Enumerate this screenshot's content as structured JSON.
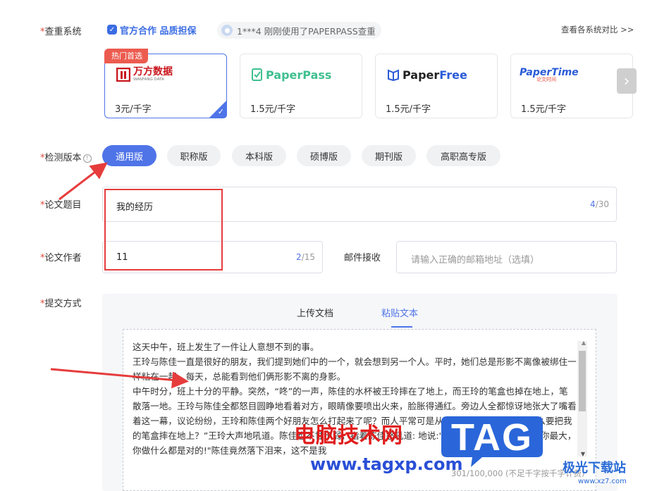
{
  "check_system": {
    "label": "查重系统",
    "promo": "官方合作 品质担保",
    "ticker": "1***4 刚刚使用了PAPERPASS查重",
    "compare_link": "查看各系统对比 >>",
    "cards": [
      {
        "logo_text": "万方数据",
        "logo_sub": "WANFANG DATA",
        "price": "3元/千字",
        "badge": "热门首选",
        "selected": true
      },
      {
        "logo_text": "PaperPass",
        "price": "1.5元/千字",
        "selected": false
      },
      {
        "logo_text_a": "Paper",
        "logo_text_b": "Free",
        "price": "1.5元/千字",
        "selected": false
      },
      {
        "logo_text": "PaperTime",
        "logo_sub": "论文时间",
        "price": "1.5元/千字",
        "selected": false
      }
    ],
    "next_icon": "chevron-right-icon"
  },
  "version": {
    "label": "检测版本",
    "options": [
      "通用版",
      "职称版",
      "本科版",
      "硕博版",
      "期刊版",
      "高职高专版"
    ],
    "selected": "通用版"
  },
  "title_field": {
    "label": "论文题目",
    "value": "我的经历",
    "count_current": "4",
    "count_max": "/30"
  },
  "author_field": {
    "label": "论文作者",
    "value": "11",
    "count_current": "2",
    "count_max": "/15"
  },
  "email_field": {
    "label": "邮件接收",
    "placeholder": "请输入正确的邮箱地址（选填）"
  },
  "submit": {
    "label": "提交方式",
    "tabs": [
      "上传文档",
      "粘贴文本"
    ],
    "active_tab": "粘贴文本",
    "text": "这天中午，班上发生了一件让人意想不到的事。\n王玲与陈佳一直是很好的朋友，我们提到她们中的一个，就会想到另一个人。平时，她们总是形影不离像被绑住一样粘在一起，每天，总能看到他们俩形影不离的身影。\n中午时分，班上十分的平静。突然，“咚”的一声，陈佳的水杯被王玲摔在了地上，而王玲的笔盒也掉在地上，笔散落一地。王玲与陈佳全都怒目圆睁地看着对方，眼睛像要喷出火来，脸胀得通红。旁边人全都惊讶地张大了嘴看着这一幕，议论纷纷，王玲和陈佳两个好朋友怎么打起来了呢？而人平常可是从来不会这样的。“你为什么要把我的笔盒摔在地上？”王玲大声地吼道。陈佳也不甘示弱，指着陈佳怒吼道: 地说:\"不小心可以了吧，全世界你最大，你做什么都是对的!\"陈佳竟然落下泪来，这不是我",
    "char_count": "301/100,000 (不足千字按千字计费)"
  },
  "watermarks": {
    "site_name": "电脑技术网",
    "site_url": "www.tagxp.com",
    "tag_logo": "TAG",
    "corner_name": "极光下载站",
    "corner_url": "www.xz7.com"
  },
  "colors": {
    "accent": "#4f74e8",
    "required": "#e5483b",
    "hot_badge": "#ec5b4f",
    "annotation": "#e63c3c"
  }
}
